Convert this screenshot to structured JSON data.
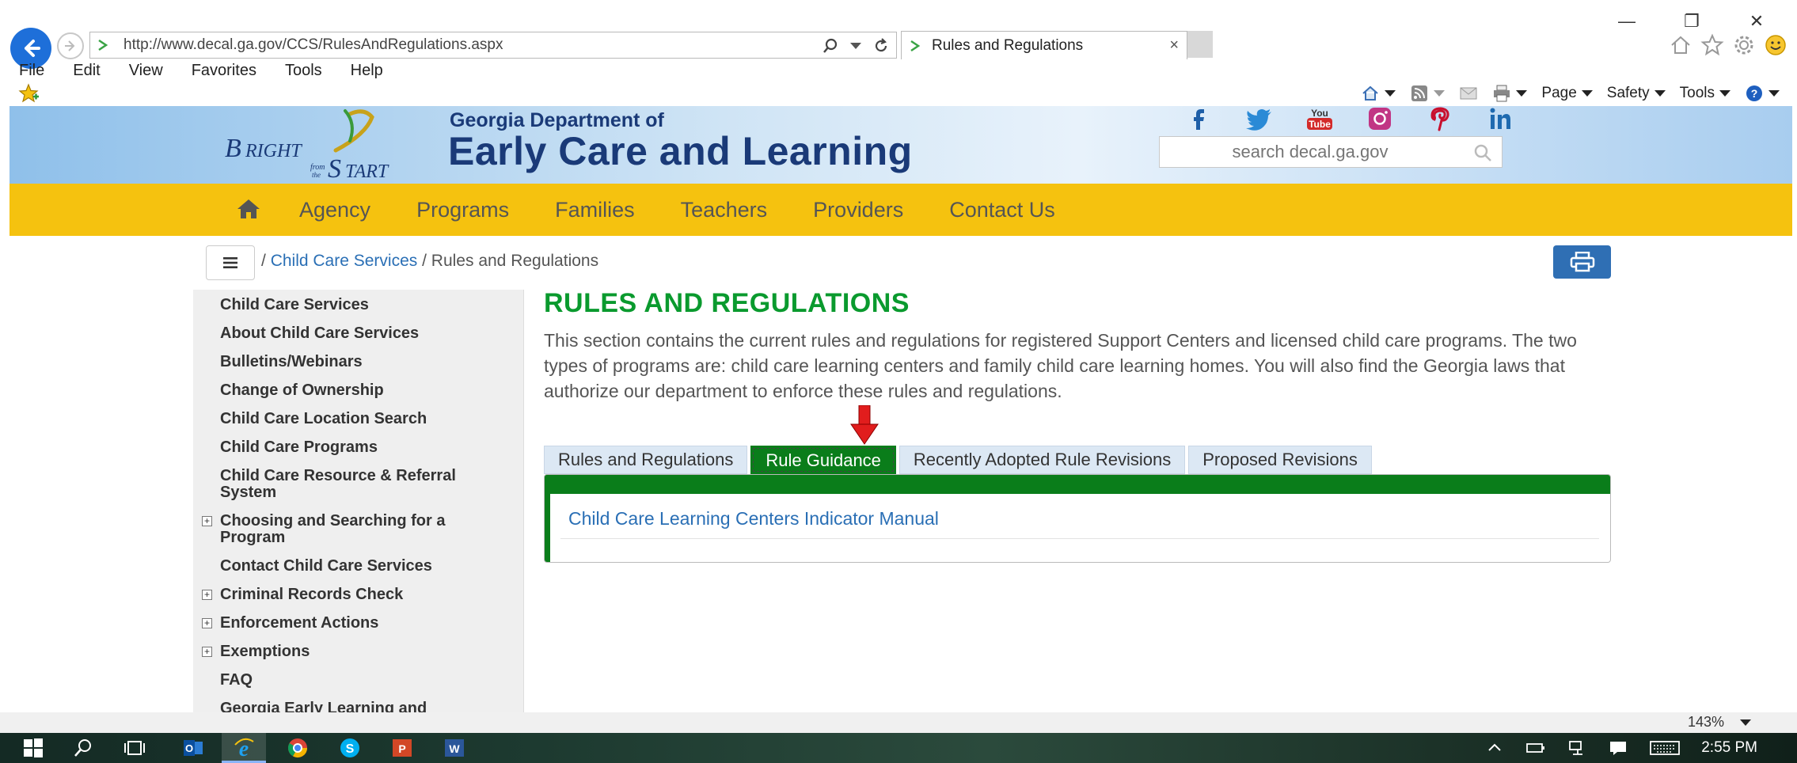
{
  "browser": {
    "url": "http://www.decal.ga.gov/CCS/RulesAndRegulations.aspx",
    "tab_title": "Rules and Regulations",
    "tab_close": "×",
    "window_controls": {
      "minimize": "—",
      "restore": "❐",
      "close": "✕"
    },
    "menu": [
      "File",
      "Edit",
      "View",
      "Favorites",
      "Tools",
      "Help"
    ],
    "commands": {
      "page": "Page",
      "safety": "Safety",
      "tools": "Tools"
    }
  },
  "site": {
    "dept_small": "Georgia Department of",
    "dept_big": "Early Care and Learning",
    "search_placeholder": "search decal.ga.gov",
    "socials": [
      "facebook-icon",
      "twitter-icon",
      "youtube-icon",
      "instagram-icon",
      "pinterest-icon",
      "linkedin-icon"
    ],
    "nav": [
      "Agency",
      "Programs",
      "Families",
      "Teachers",
      "Providers",
      "Contact Us"
    ],
    "breadcrumb": {
      "sep1": "/",
      "link": "Child Care Services",
      "sep2": "/",
      "current": "Rules and Regulations"
    }
  },
  "sidebar": {
    "items": [
      {
        "label": "Child Care Services",
        "plus": false
      },
      {
        "label": "About Child Care Services",
        "plus": false
      },
      {
        "label": "Bulletins/Webinars",
        "plus": false
      },
      {
        "label": "Change of Ownership",
        "plus": false
      },
      {
        "label": "Child Care Location Search",
        "plus": false
      },
      {
        "label": "Child Care Programs",
        "plus": false
      },
      {
        "label": "Child Care Resource & Referral System",
        "plus": false
      },
      {
        "label": "Choosing and Searching for a Program",
        "plus": true
      },
      {
        "label": "Contact Child Care Services",
        "plus": false
      },
      {
        "label": "Criminal Records Check",
        "plus": true
      },
      {
        "label": "Enforcement Actions",
        "plus": true
      },
      {
        "label": "Exemptions",
        "plus": true
      },
      {
        "label": "FAQ",
        "plus": false
      },
      {
        "label": "Georgia Early Learning and",
        "plus": false
      }
    ],
    "plus_glyph": "+"
  },
  "main": {
    "title": "RULES AND REGULATIONS",
    "intro": "This section contains the current rules and regulations for registered Support Centers and licensed child care programs. The two types of programs are: child care learning centers and family child care learning homes. You will also find the Georgia laws that authorize our department to enforce these rules and regulations.",
    "tabs": [
      "Rules and Regulations",
      "Rule Guidance",
      "Recently Adopted Rule Revisions",
      "Proposed Revisions"
    ],
    "active_tab": "Rule Guidance",
    "doc_link": "Child Care Learning Centers Indicator Manual"
  },
  "status": {
    "zoom": "143%"
  },
  "taskbar": {
    "time": "2:55 PM"
  },
  "colors": {
    "accent_green": "#0a7d1a",
    "title_green": "#0a9a2e",
    "nav_yellow": "#f5c20f",
    "navy": "#1a3a78",
    "link_blue": "#2a6fb5"
  }
}
